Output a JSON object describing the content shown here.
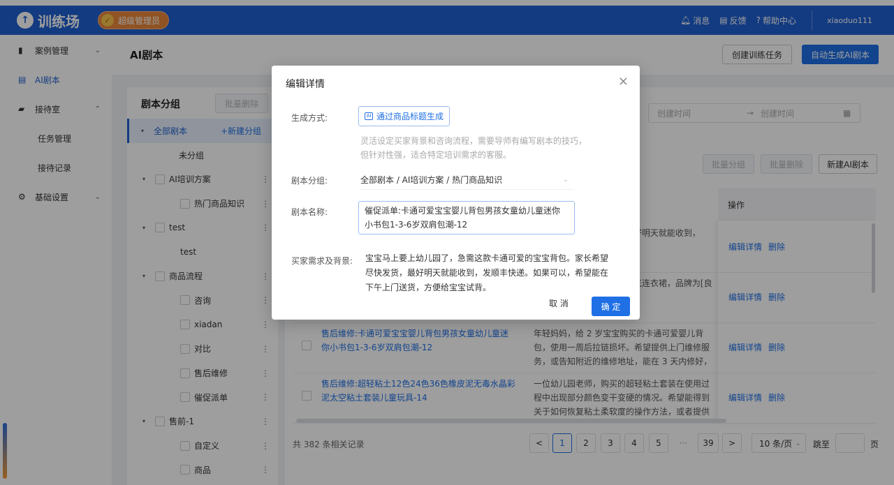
{
  "header": {
    "logo_text": "训练场",
    "role_badge": "超级管理员",
    "messages": "消息",
    "feedback": "反馈",
    "help": "帮助中心",
    "username": "xiaoduo111"
  },
  "sidebar": {
    "items": [
      {
        "label": "案例管理",
        "icon": "book-icon"
      },
      {
        "label": "AI剧本",
        "icon": "document-icon"
      },
      {
        "label": "接待室",
        "icon": "chat-icon"
      },
      {
        "label": "任务管理"
      },
      {
        "label": "接待记录"
      },
      {
        "label": "基础设置",
        "icon": "gear-icon"
      }
    ]
  },
  "main": {
    "title": "AI剧本",
    "create_task_button": "创建训练任务",
    "auto_generate_button": "自动生成AI剧本",
    "date_start_placeholder": "创建时间",
    "date_end_placeholder": "创建时间",
    "batch_group_button": "批量分组",
    "batch_delete_button": "批量删除",
    "new_script_button": "新建AI剧本",
    "op_header": "操作",
    "edit_link": "编辑详情",
    "delete_link": "删除"
  },
  "group_panel": {
    "title": "剧本分组",
    "batch_delete": "批量删除",
    "all_scripts": "全部剧本",
    "new_group": "+新建分组",
    "tree": [
      {
        "label": "未分组",
        "level": 1,
        "caret": false,
        "checkbox": false
      },
      {
        "label": "AI培训方案",
        "level": 1,
        "caret": true,
        "checkbox": true
      },
      {
        "label": "热门商品知识",
        "level": 2,
        "caret": false,
        "checkbox": true
      },
      {
        "label": "test",
        "level": 1,
        "caret": true,
        "checkbox": true
      },
      {
        "label": "test",
        "level": 2,
        "caret": false,
        "checkbox": false
      },
      {
        "label": "商品流程",
        "level": 1,
        "caret": true,
        "checkbox": true
      },
      {
        "label": "咨询",
        "level": 2,
        "caret": false,
        "checkbox": true
      },
      {
        "label": "xiadan",
        "level": 2,
        "caret": false,
        "checkbox": true
      },
      {
        "label": "对比",
        "level": 2,
        "caret": false,
        "checkbox": true
      },
      {
        "label": "售后维修",
        "level": 2,
        "caret": false,
        "checkbox": true
      },
      {
        "label": "催促派单",
        "level": 2,
        "caret": false,
        "checkbox": true
      },
      {
        "label": "售前-1",
        "level": 1,
        "caret": true,
        "checkbox": true
      },
      {
        "label": "自定义",
        "level": 2,
        "caret": false,
        "checkbox": true
      },
      {
        "label": "商品",
        "level": 2,
        "caret": false,
        "checkbox": true
      }
    ]
  },
  "table": {
    "rows": [
      {
        "title": "",
        "desc": "...这款卡通可爱的宝宝...最好明天就能收到，发...能在下午上门送货，..."
      },
      {
        "title": "",
        "desc": "...双韩系风格。希望购买...花连衣裙，品牌为[良仿...中长款，能展现气质..."
      },
      {
        "title": "售后维修:卡通可爱宝宝婴儿背包男孩女童幼儿童迷你小书包1-3-6岁双肩包潮-12",
        "desc": "年轻妈妈，给 2 岁宝宝购买的卡通可爱婴儿背包，使用一周后拉链损坏。希望提供上门维修服务，或告知附近的维修地址，能在 3 天内修好，不影响..."
      },
      {
        "title": "售后维修:超轻粘土12色24色36色橡皮泥无毒水晶彩泥太空粘土套装儿童玩具-14",
        "desc": "一位幼儿园老师，购买的超轻粘土套装在使用过程中出现部分颜色变干变硬的情况。希望能得到关于如何恢复粘土柔软度的操作方法，或者提供修..."
      }
    ],
    "total": "共 382 条相关记录"
  },
  "pagination": {
    "prev": "<",
    "pages": [
      "1",
      "2",
      "3",
      "4",
      "5"
    ],
    "ellipsis": "···",
    "last": "39",
    "next": ">",
    "page_size": "10 条/页",
    "jump_label": "跳至",
    "jump_suffix": "页"
  },
  "modal": {
    "title": "编辑详情",
    "gen_label": "生成方式:",
    "gen_button": "通过商品标题生成",
    "gen_hint": "灵活设定买家背景和咨询流程，需要导师有编写剧本的技巧，但针对性强，适合特定培训需求的客服。",
    "group_label": "剧本分组:",
    "group_value": "全部剧本 / AI培训方案 / 热门商品知识",
    "name_label": "剧本名称:",
    "name_value": "催促派单:卡通可爱宝宝婴儿背包男孩女童幼儿童迷你小书包1-3-6岁双肩包潮-12",
    "bg_label": "买家需求及背景:",
    "bg_value": "宝宝马上要上幼儿园了，急需这款卡通可爱的宝宝背包。家长希望尽快发货，最好明天就能收到，发顺丰快递。如果可以，希望能在下午上门送货，方便给宝宝试背。",
    "cancel": "取 消",
    "ok": "确 定"
  },
  "colors": {
    "brand": "#1f5fd1",
    "primary": "#1f6fe5",
    "badge": "#e8863b"
  }
}
